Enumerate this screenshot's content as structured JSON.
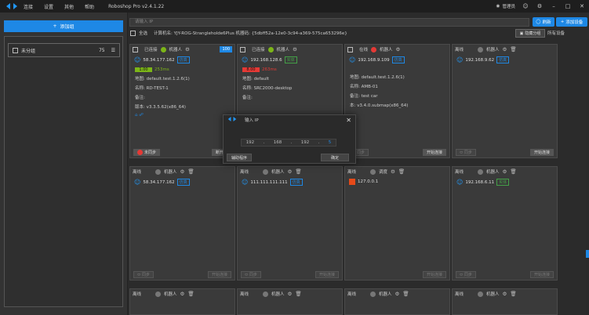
{
  "app": {
    "title": "Roboshop Pro v2.4.1.22",
    "menu": [
      "连接",
      "设置",
      "其他",
      "帮助"
    ],
    "user": "管理员"
  },
  "left": {
    "add_group": "添加组",
    "group": {
      "name": "未分组",
      "count": "75"
    }
  },
  "toolbar": {
    "search_placeholder": "请输入 IP",
    "refresh": "刷新",
    "add_device": "添加设备",
    "select_all": "全选",
    "machine_info": "计算机名: YJY-ROG-Strangleholde6Plus 机器码: {5dbff52a-12e0-3c94-a369-575ca653296e}",
    "hide_group": "隐藏分组",
    "all_devices": "所有设备"
  },
  "cards_row1": [
    {
      "status": "已连接",
      "type": "机器人",
      "num": "100",
      "ip": "58.34.177.162",
      "badge": "仿真",
      "ping": "1.00",
      "ping_ms": "253ms",
      "map": "地图:  default.test.1.2.6(1)",
      "name": "名称:  RD-TEST-1",
      "note": "备注:",
      "ver": "版本: v3.3.5.62(x86_64)",
      "foot_l": "未同步",
      "foot_r": "断开连"
    },
    {
      "status": "已连接",
      "type": "机器人",
      "num": "",
      "ip": "192.168.128.6",
      "badge": "实体",
      "ping": "8.00",
      "ping_ms": "263ms",
      "map": "地图:  default",
      "name": "名称:  SRC2000-desktop",
      "note": "备注:",
      "ver": "",
      "foot_l": "",
      "foot_r": ""
    },
    {
      "status": "在线",
      "type": "机器人",
      "num": "",
      "ip": "192.168.9.109",
      "badge": "仿真",
      "ping": "",
      "ping_ms": "",
      "map": "地图:  default.test.1.2.6(1)",
      "name": "名称:  AMB-01",
      "note": "备注:  test car",
      "ver": "本: v3.4.0.submap(x86_64)",
      "foot_l": "",
      "foot_r": "开始连接"
    },
    {
      "status": "离线",
      "type": "机器人",
      "num": "",
      "ip": "192.168.9.62",
      "badge": "仿真",
      "ping": "",
      "ping_ms": "",
      "map": "",
      "name": "",
      "note": "",
      "ver": "",
      "foot_l": "",
      "foot_r": "开始连接"
    }
  ],
  "cards_row2": [
    {
      "status": "离线",
      "type": "机器人",
      "ip": "58.34.177.162",
      "badge": "仿真",
      "foot_r": "开始连接"
    },
    {
      "status": "离线",
      "type": "机器人",
      "ip": "111.111.111.111",
      "badge": "仿真",
      "foot_r": "开始连接"
    },
    {
      "status": "离线",
      "type": "调度",
      "ip": "127.0.0.1",
      "badge": "",
      "foot_r": "开始连接"
    },
    {
      "status": "离线",
      "type": "机器人",
      "ip": "192.168.6.11",
      "badge": "实体",
      "foot_r": "开始连接"
    }
  ],
  "cards_row3": [
    {
      "status": "离线",
      "type": "机器人"
    },
    {
      "status": "离线",
      "type": "机器人"
    },
    {
      "status": "离线",
      "type": "机器人"
    },
    {
      "status": "离线",
      "type": "机器人"
    }
  ],
  "dialog": {
    "title": "输入 IP",
    "octets": [
      "192",
      "168",
      "192",
      "5"
    ],
    "assist": "辅助程序",
    "confirm": "确定"
  },
  "colors": {
    "accent": "#1e88e5",
    "ok": "#7cb518",
    "err": "#e53935"
  }
}
